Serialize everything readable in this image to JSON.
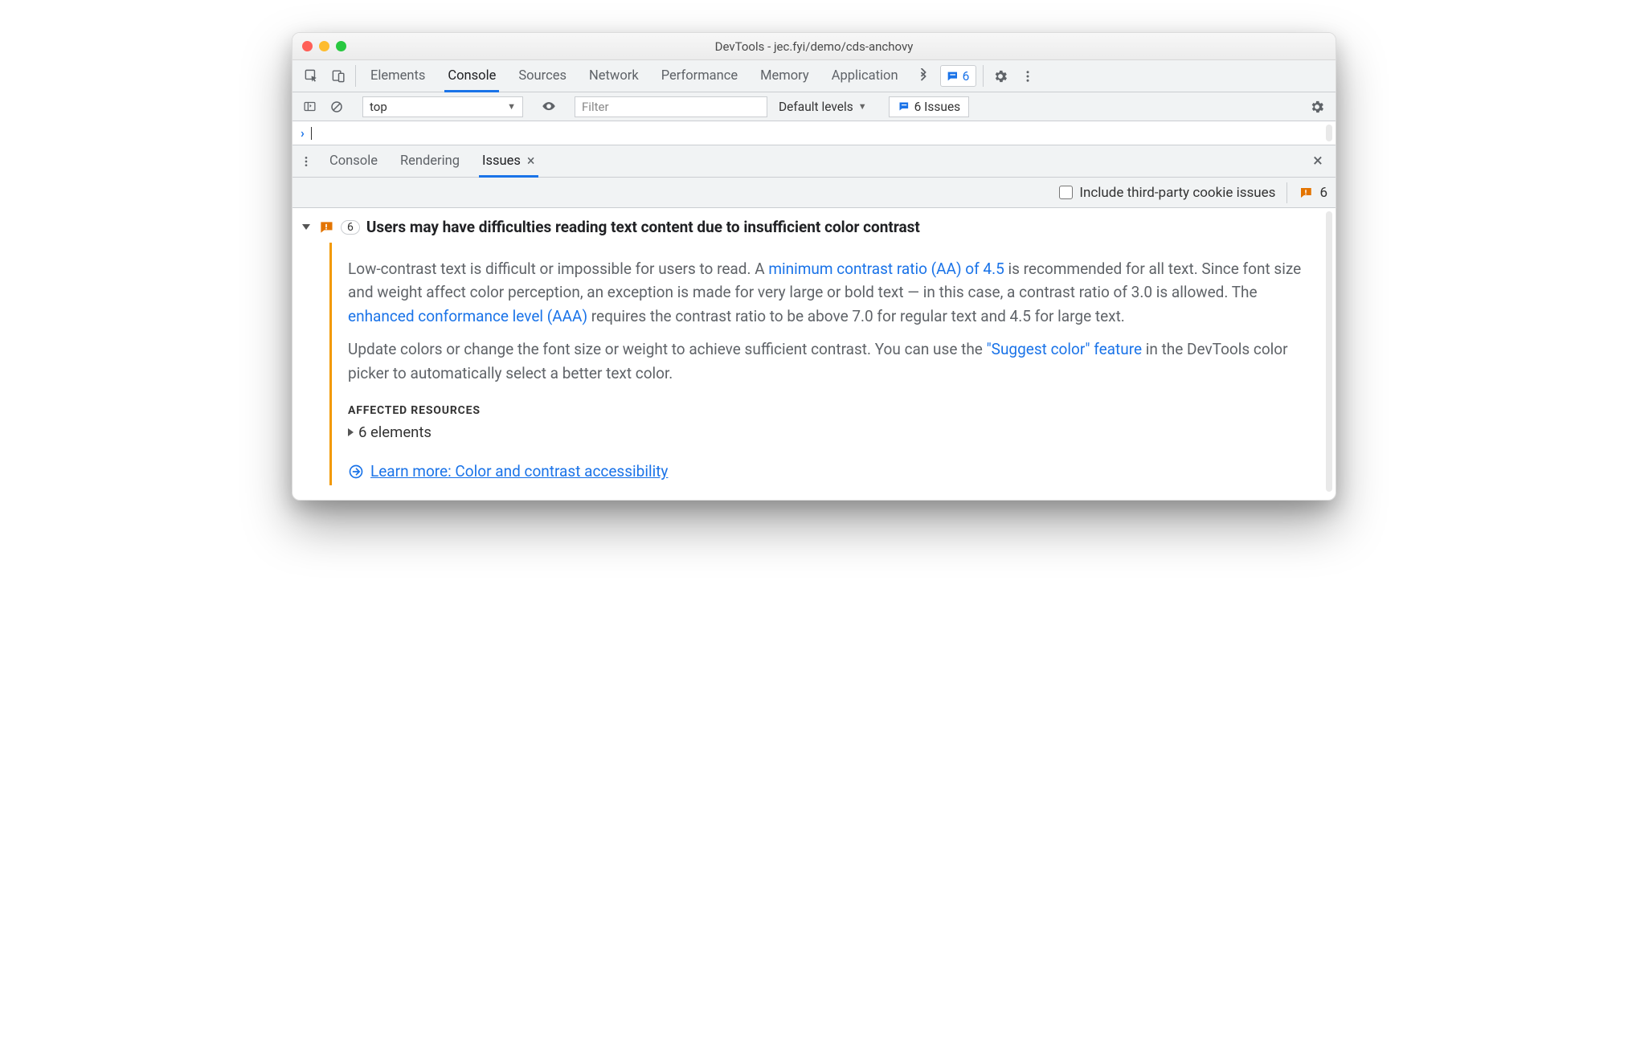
{
  "window_title": "DevTools - jec.fyi/demo/cds-anchovy",
  "main_tabs": {
    "items": [
      "Elements",
      "Console",
      "Sources",
      "Network",
      "Performance",
      "Memory",
      "Application"
    ],
    "active_index": 1,
    "issues_badge_count": "6"
  },
  "console_toolbar": {
    "context": "top",
    "filter_placeholder": "Filter",
    "levels_label": "Default levels",
    "issues_label": "6 Issues"
  },
  "drawer": {
    "tabs": [
      "Console",
      "Rendering",
      "Issues"
    ],
    "active_index": 2,
    "toolbar": {
      "include_third_party_label": "Include third-party cookie issues",
      "warning_count": "6"
    }
  },
  "issue": {
    "count": "6",
    "title": "Users may have difficulties reading text content due to insufficient color contrast",
    "p1_seg1": "Low-contrast text is difficult or impossible for users to read. A ",
    "p1_link1": "minimum contrast ratio (AA) of 4.5",
    "p1_seg2": " is recommended for all text. Since font size and weight affect color perception, an exception is made for very large or bold text — in this case, a contrast ratio of 3.0 is allowed. The ",
    "p1_link2": "enhanced conformance level (AAA)",
    "p1_seg3": " requires the contrast ratio to be above 7.0 for regular text and 4.5 for large text.",
    "p2_seg1": "Update colors or change the font size or weight to achieve sufficient contrast. You can use the ",
    "p2_link1": "\"Suggest color\" feature",
    "p2_seg2": " in the DevTools color picker to automatically select a better text color.",
    "affected_title": "AFFECTED RESOURCES",
    "affected_item": "6 elements",
    "learn_more": "Learn more: Color and contrast accessibility"
  }
}
